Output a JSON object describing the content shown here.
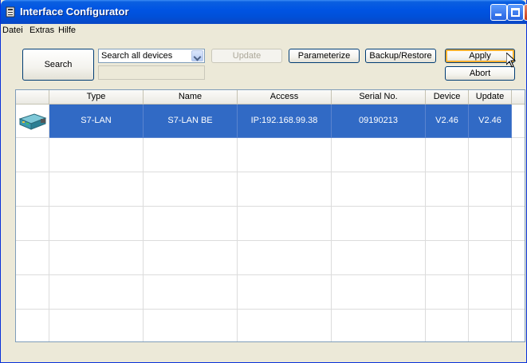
{
  "window": {
    "title": "Interface Configurator"
  },
  "menu": [
    "Datei",
    "Extras",
    "Hilfe"
  ],
  "toolbar": {
    "search_label": "Search",
    "search_scope": "Search all devices",
    "update_label": "Update",
    "parameterize_label": "Parameterize",
    "backup_restore_label": "Backup/Restore",
    "apply_label": "Apply",
    "abort_label": "Abort"
  },
  "table": {
    "columns": [
      "Type",
      "Name",
      "Access",
      "Serial No.",
      "Device",
      "Update"
    ],
    "rows": [
      {
        "icon": "network-device-icon",
        "type": "S7-LAN",
        "name": "S7-LAN BE",
        "access": "IP:192.168.99.38",
        "serial": "09190213",
        "device": "V2.46",
        "update": "V2.46"
      }
    ]
  },
  "colors": {
    "selection": "#316ac5",
    "titlebar": "#0054e3",
    "face": "#ece9d8"
  }
}
